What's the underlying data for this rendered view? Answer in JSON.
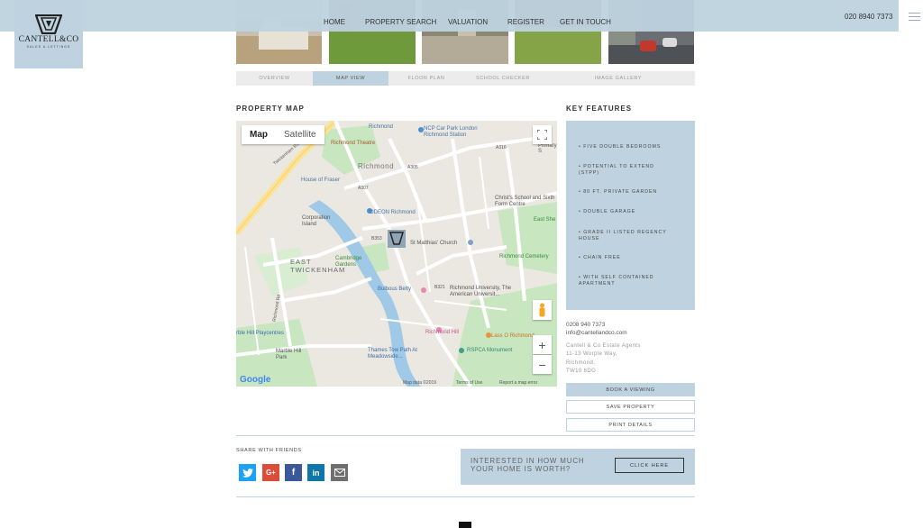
{
  "header": {
    "brand_name": "CANTELL&CO",
    "brand_tagline": "SALES & LETTINGS",
    "nav": [
      "HOME",
      "PROPERTY SEARCH",
      "VALUATION",
      "REGISTER",
      "GET IN TOUCH"
    ],
    "phone": "020 8940 7373",
    "menu_icon": "hamburger-icon"
  },
  "tabs": [
    {
      "label": "OVERVIEW",
      "active": false
    },
    {
      "label": "MAP VIEW",
      "active": true
    },
    {
      "label": "FLOOR PLAN",
      "active": false
    },
    {
      "label": "SCHOOL CHECKER",
      "active": false
    },
    {
      "label": "IMAGE GALLERY",
      "active": false
    }
  ],
  "map_section": {
    "title": "PROPERTY MAP",
    "type_buttons": [
      "Map",
      "Satellite"
    ],
    "labels": {
      "richmond_station": "Richmond",
      "ncp": "NCP Car Park London Richmond Station",
      "richmond_theatre": "Richmond Theatre",
      "richmond": "Richmond",
      "house_of_fraser": "House of Fraser",
      "odeon": "ODEON Richmond",
      "corporation_island": "Corporation Island",
      "st_matthias": "St Matthias' Church",
      "east_twickenham": "EAST TWICKENHAM",
      "cambridge_gardens": "Cambridge Gardens",
      "bulbous_betty": "Bulbous Betty",
      "richmond_university": "Richmond University, The American Universit...",
      "richmond_cemetery": "Richmond Cemetery",
      "christs_school": "Christ's School and Sixth Form Centre",
      "east_she": "East She",
      "primary_s": "Primary S",
      "marble_hill_playcentres": "rble Hill Playcentres",
      "richmond_hill": "Richmond Hill",
      "lass_o_richmond": "Lass O Richmond",
      "rspca": "RSPCA Monument",
      "thames_tow_path": "Thames Tow Path At Meadowside...",
      "marble_hill_park": "Marble Hill Park",
      "a305": "A305",
      "a307": "A307",
      "a316": "A316",
      "b353": "B353",
      "b321": "B321",
      "twickenham_rd": "Twickenham Rd",
      "richmond_rd": "Richmond Rd"
    },
    "footer": {
      "google": "Google",
      "data": "Map data ©2019",
      "terms": "Terms of Use",
      "report": "Report a map error"
    }
  },
  "key_features": {
    "title": "KEY FEATURES",
    "items": [
      "FIVE DOUBLE BEDROOMS",
      "POTENTIAL TO EXTEND (STPP)",
      "80 FT. PRIVATE GARDEN",
      "DOUBLE GARAGE",
      "GRADE II LISTED REGENCY HOUSE",
      "CHAIN FREE",
      "WITH SELF CONTAINED APARTMENT"
    ]
  },
  "contact": {
    "phone": "0208 940 7373",
    "email": "info@cantellandco.com",
    "address": [
      "Cantell & Co Estate Agents",
      "11-13 Worple Way,",
      "Richmond,",
      "TW10 6DG"
    ]
  },
  "actions": {
    "book": "BOOK A VIEWING",
    "save": "SAVE PROPERTY",
    "print": "PRINT DETAILS"
  },
  "share": {
    "title": "SHARE WITH FRIENDS",
    "icons": [
      "twitter-icon",
      "google-plus-icon",
      "facebook-icon",
      "linkedin-icon",
      "email-icon"
    ]
  },
  "cta": {
    "line1": "INTERESTED IN HOW MUCH",
    "line2": "YOUR HOME IS WORTH?",
    "button": "CLICK HERE"
  },
  "colors": {
    "accent": "#bed3df",
    "park": "#c8e6c0",
    "water": "#9fc9e6",
    "road_yellow": "#fde293"
  }
}
